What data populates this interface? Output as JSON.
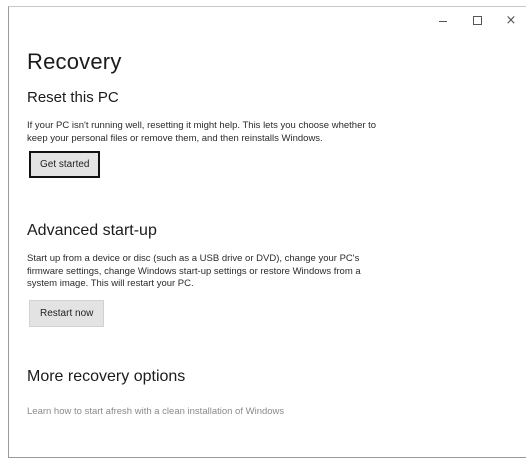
{
  "window": {
    "minimize_label": "–",
    "maximize_label": "□",
    "close_label": "×"
  },
  "page": {
    "title": "Recovery"
  },
  "reset": {
    "heading": "Reset this PC",
    "description": "If your PC isn't running well, resetting it might help. This lets you choose whether to keep your personal files or remove them, and then reinstalls Windows.",
    "button_label": "Get started"
  },
  "advanced": {
    "heading": "Advanced start-up",
    "description": "Start up from a device or disc (such as a USB drive or DVD), change your PC's firmware settings, change Windows start-up settings or restore Windows from a system image. This will restart your PC.",
    "button_label": "Restart now"
  },
  "more": {
    "heading": "More recovery options",
    "link_text": "Learn how to start afresh with a clean installation of Windows"
  }
}
